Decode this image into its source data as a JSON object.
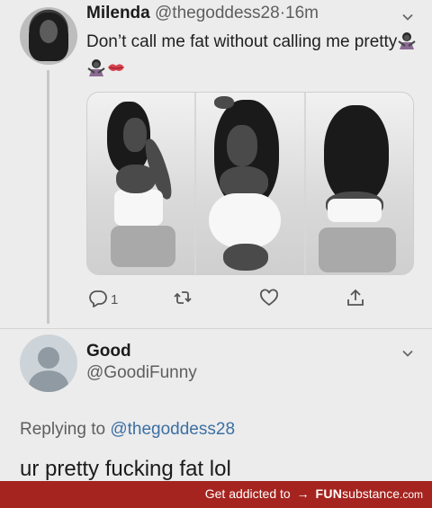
{
  "tweet1": {
    "display_name": "Milenda",
    "handle": "@thegoddess28",
    "separator": "·",
    "time": "16m",
    "text": "Don’t call me fat without calling me pretty",
    "emojis": [
      "woman-gesturing-no-icon",
      "woman-gesturing-no-icon",
      "kiss-mark-icon"
    ],
    "reply_count": "1"
  },
  "tweet2": {
    "display_name": "Good",
    "handle": "@GoodiFunny",
    "replying_prefix": "Replying to",
    "replying_handle": "@thegoddess28",
    "text": "ur pretty fucking fat lol"
  },
  "footer": {
    "prefix": "Get addicted to",
    "arrow": "→",
    "brand_bold": "FUN",
    "brand_rest": "substance",
    "domain": ".com"
  },
  "colors": {
    "footer_bg": "#a5241f",
    "link": "#3c6fa3"
  }
}
